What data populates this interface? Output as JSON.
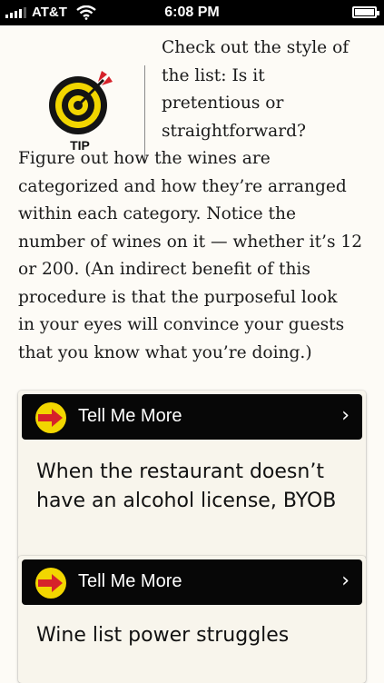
{
  "status_bar": {
    "carrier": "AT&T",
    "time": "6:08 PM",
    "battery_level": 1.0
  },
  "tip": {
    "label": "TIP",
    "icon": "target-dart-icon",
    "lines": [
      "Check out the style of",
      "the list: Is it",
      "pretentious or",
      "straightforward?"
    ]
  },
  "paragraph": {
    "lines": [
      "Figure out how the wines are",
      "categorized and how they’re arranged",
      "within each category. Notice the",
      "number of wines on it — whether it’s 12",
      "or 200. (An indirect benefit of this",
      "procedure is that the purposeful look",
      "in your eyes will convince your guests",
      "that you know what you’re doing.)"
    ]
  },
  "cards": [
    {
      "header": "Tell Me More",
      "icon": "arrow-badge-icon",
      "chevron": "›",
      "body_lines": [
        "When the restaurant doesn’t",
        "have an alcohol license, BYOB"
      ]
    },
    {
      "header": "Tell Me More",
      "icon": "arrow-badge-icon",
      "chevron": "›",
      "body_lines": [
        "Wine list power struggles"
      ]
    }
  ],
  "colors": {
    "background": "#fdfbf6",
    "header_bg": "#070707",
    "badge_yellow": "#f2d600",
    "arrow_red": "#d6222a"
  }
}
